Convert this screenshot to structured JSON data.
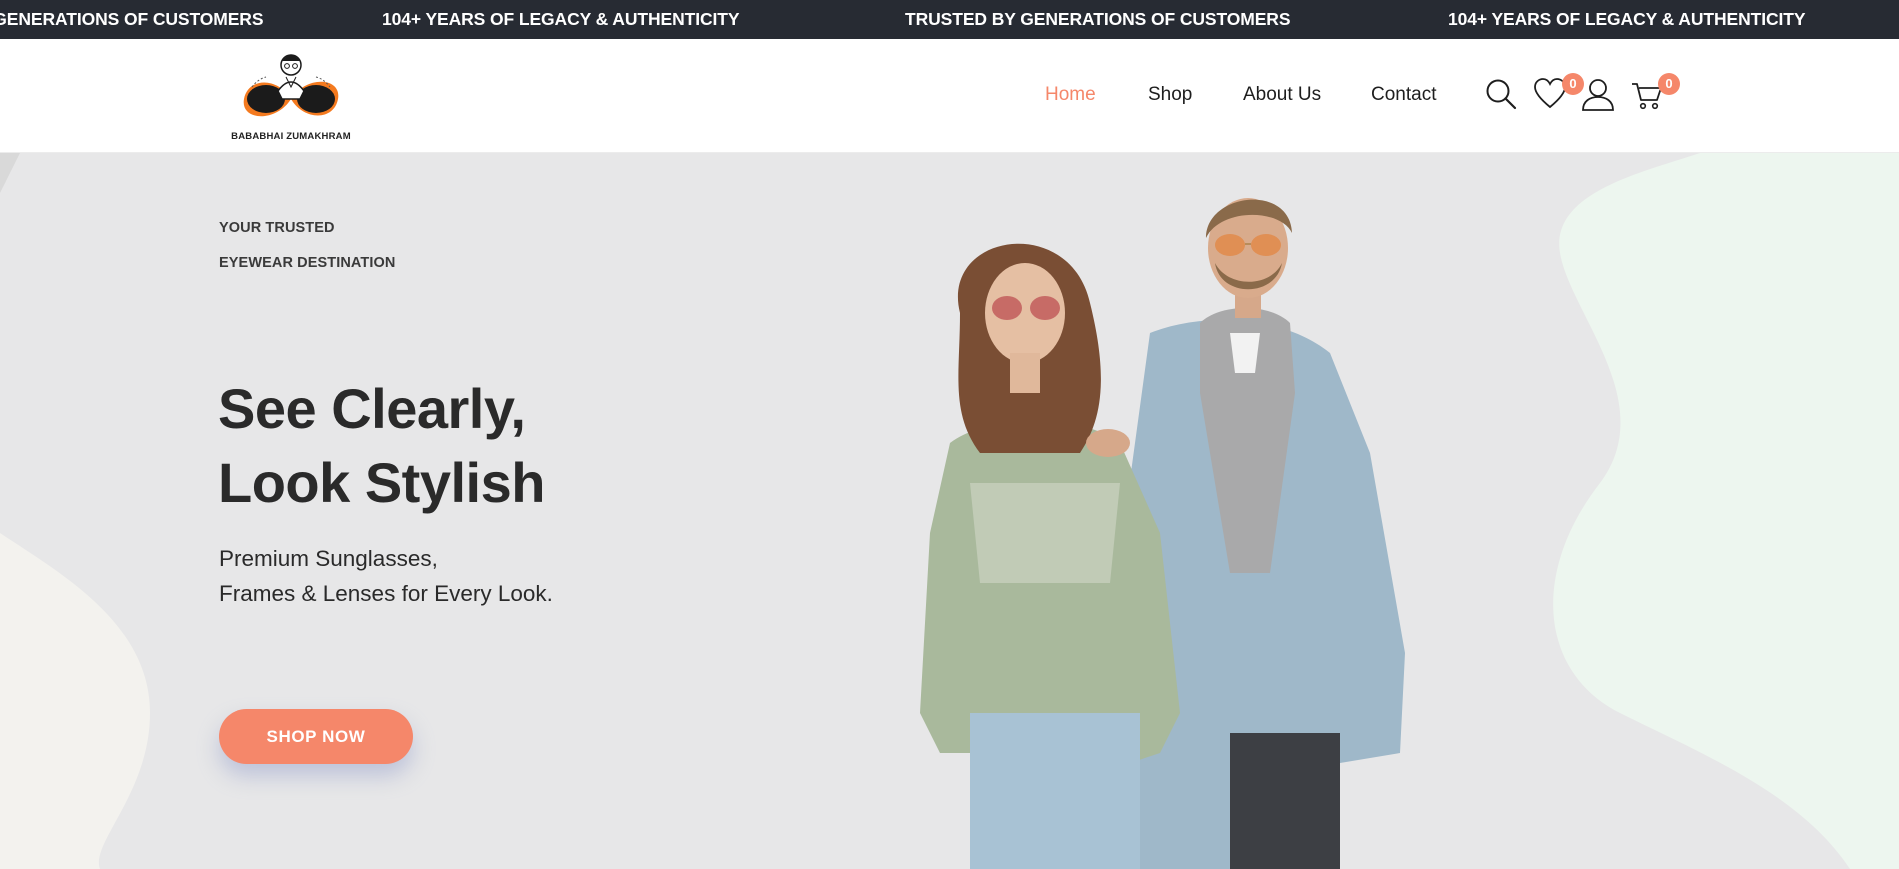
{
  "announcement_bar": {
    "items": [
      "TRUSTED BY GENERATIONS OF CUSTOMERS",
      "104+ YEARS OF LEGACY & AUTHENTICITY",
      "TRUSTED BY GENERATIONS OF CUSTOMERS",
      "104+ YEARS OF LEGACY & AUTHENTICITY"
    ]
  },
  "brand": {
    "name": "BABABHAI ZUMAKHRAM"
  },
  "nav": {
    "items": [
      {
        "label": "Home",
        "active": true
      },
      {
        "label": "Shop",
        "active": false
      },
      {
        "label": "About Us",
        "active": false
      },
      {
        "label": "Contact",
        "active": false
      }
    ]
  },
  "header_icons": {
    "search": "search-icon",
    "wishlist": "heart-icon",
    "account": "user-icon",
    "cart": "cart-icon",
    "wishlist_count": "0",
    "cart_count": "0"
  },
  "hero": {
    "eyebrow_line1": "YOUR TRUSTED",
    "eyebrow_line2": "EYEWEAR DESTINATION",
    "headline_line1": "See Clearly,",
    "headline_line2": "Look Stylish",
    "sub_line1": "Premium Sunglasses,",
    "sub_line2": "Frames & Lenses for Every Look.",
    "cta_label": "SHOP NOW"
  },
  "colors": {
    "accent": "#f5876a",
    "top_bar": "#272b33",
    "hero_bg": "#e7e7e8"
  }
}
